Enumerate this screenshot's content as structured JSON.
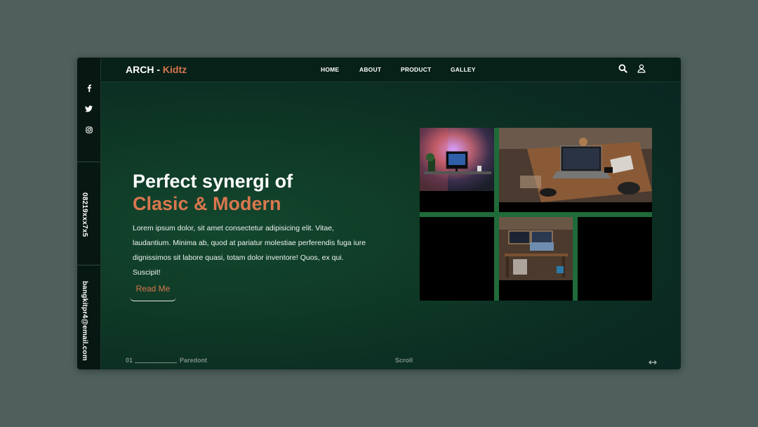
{
  "brand": {
    "name": "ARCH - ",
    "accent": "Kidtz"
  },
  "nav": {
    "items": [
      "HOME",
      "ABOUT",
      "PRODUCT",
      "GALLEY"
    ]
  },
  "icons": {
    "search": "search-icon",
    "user": "user-icon",
    "facebook": "facebook-icon",
    "twitter": "twitter-icon",
    "instagram": "instagram-icon",
    "arrows": "horizontal-arrows-icon"
  },
  "sidebar": {
    "phone": "08219xxx7x5",
    "email": "bangkitpr4@email.com"
  },
  "hero": {
    "title_line1": "Perfect synergi of",
    "title_line2": "Clasic & Modern",
    "description": "Lorem ipsum dolor, sit amet consectetur adipisicing elit. Vitae, laudantium. Minima ab, quod at pariatur molestiae perferendis fuga iure dignissimos sit labore quasi, totam dolor inventore! Quos, ex qui. Suscipit!",
    "button": "Read Me"
  },
  "footer": {
    "index": "01",
    "label": "Paredont",
    "scroll": "Scroll"
  },
  "colors": {
    "accent": "#d9774f",
    "background": "#0f3a26",
    "gallery_gap": "#1f6b3a"
  }
}
